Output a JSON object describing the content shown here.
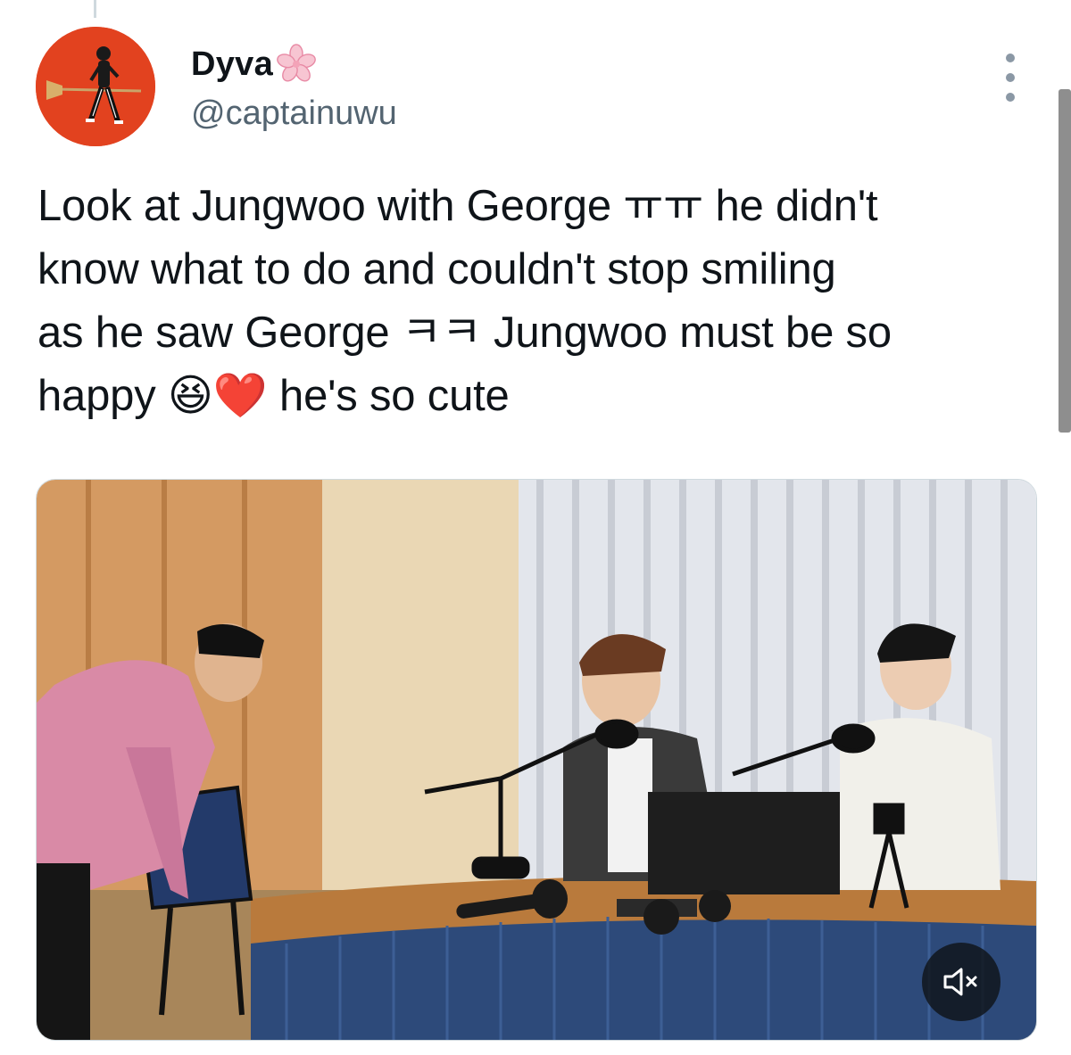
{
  "tweet": {
    "author": {
      "display_name": "Dyva",
      "name_emoji": "cherry-blossom-icon",
      "handle": "@captainuwu"
    },
    "text_lines": [
      "Look at Jungwoo with George ㅠㅠ he didn't",
      "know what to do and couldn't stop smiling",
      "as he saw George ㅋㅋ Jungwoo must be so"
    ],
    "text_last": {
      "before": "happy ",
      "emoji1": "😆",
      "emoji2": "❤️",
      "after": " he's so cute"
    },
    "media": {
      "type": "video",
      "muted_icon": "speaker-muted-icon"
    }
  },
  "colors": {
    "text": "#0f1419",
    "secondary": "#536471",
    "avatar_bg": "#e2421f",
    "thread_line": "#cfd9de"
  }
}
